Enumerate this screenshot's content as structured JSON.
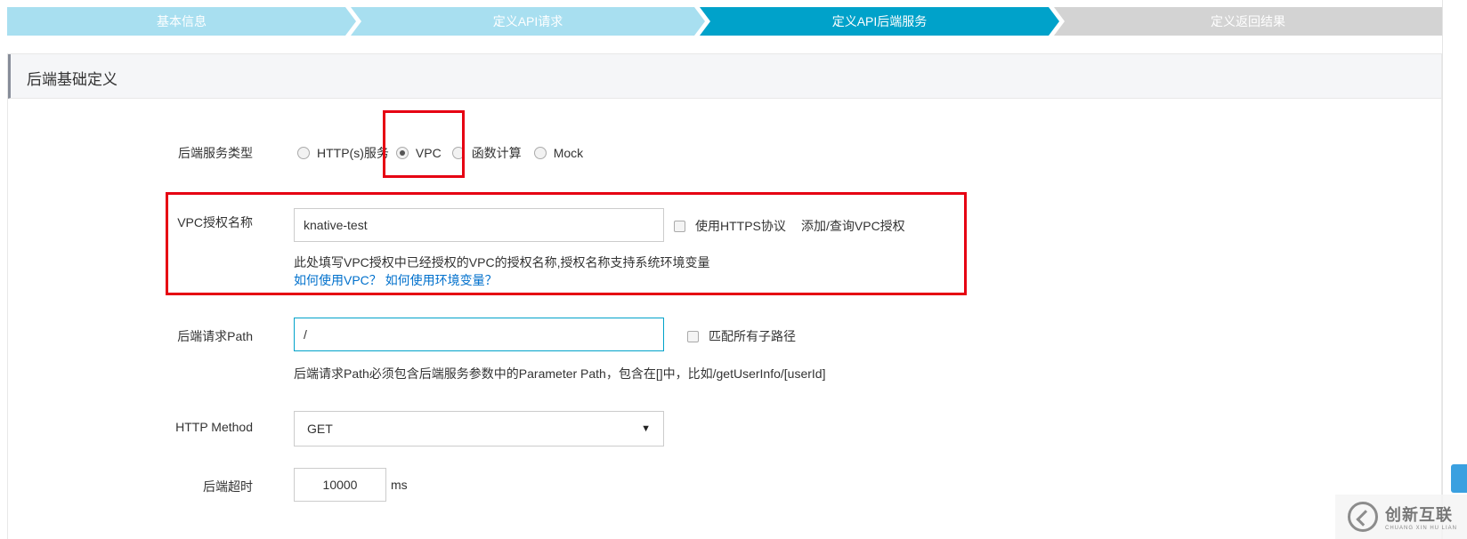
{
  "steps": [
    {
      "label": "基本信息",
      "state": "done"
    },
    {
      "label": "定义API请求",
      "state": "done"
    },
    {
      "label": "定义API后端服务",
      "state": "active"
    },
    {
      "label": "定义返回结果",
      "state": "todo"
    }
  ],
  "colors": {
    "step_done": "#a8dff0",
    "step_active": "#00a2ca",
    "step_todo": "#d3d3d3",
    "highlight": "#e60012",
    "link": "#0070cc"
  },
  "section": {
    "title": "后端基础定义"
  },
  "backend_type": {
    "label": "后端服务类型",
    "options": [
      "HTTP(s)服务",
      "VPC",
      "函数计算",
      "Mock"
    ],
    "selected": "VPC"
  },
  "vpc": {
    "label": "VPC授权名称",
    "value": "knative-test",
    "https_checkbox": "使用HTTPS协议",
    "add_link": "添加/查询VPC授权",
    "hint": "此处填写VPC授权中已经授权的VPC的授权名称,授权名称支持系统环境变量",
    "help_link_vpc": "如何使用VPC？",
    "help_link_env": "如何使用环境变量？"
  },
  "path": {
    "label": "后端请求Path",
    "value": "/",
    "match_checkbox": "匹配所有子路径",
    "hint": "后端请求Path必须包含后端服务参数中的Parameter Path，包含在[]中，比如/getUserInfo/[userId]"
  },
  "method": {
    "label": "HTTP Method",
    "value": "GET"
  },
  "timeout": {
    "label": "后端超时",
    "value": "10000",
    "unit": "ms"
  },
  "watermark": {
    "main": "创新互联",
    "sub": "CHUANG XIN HU LIAN"
  }
}
